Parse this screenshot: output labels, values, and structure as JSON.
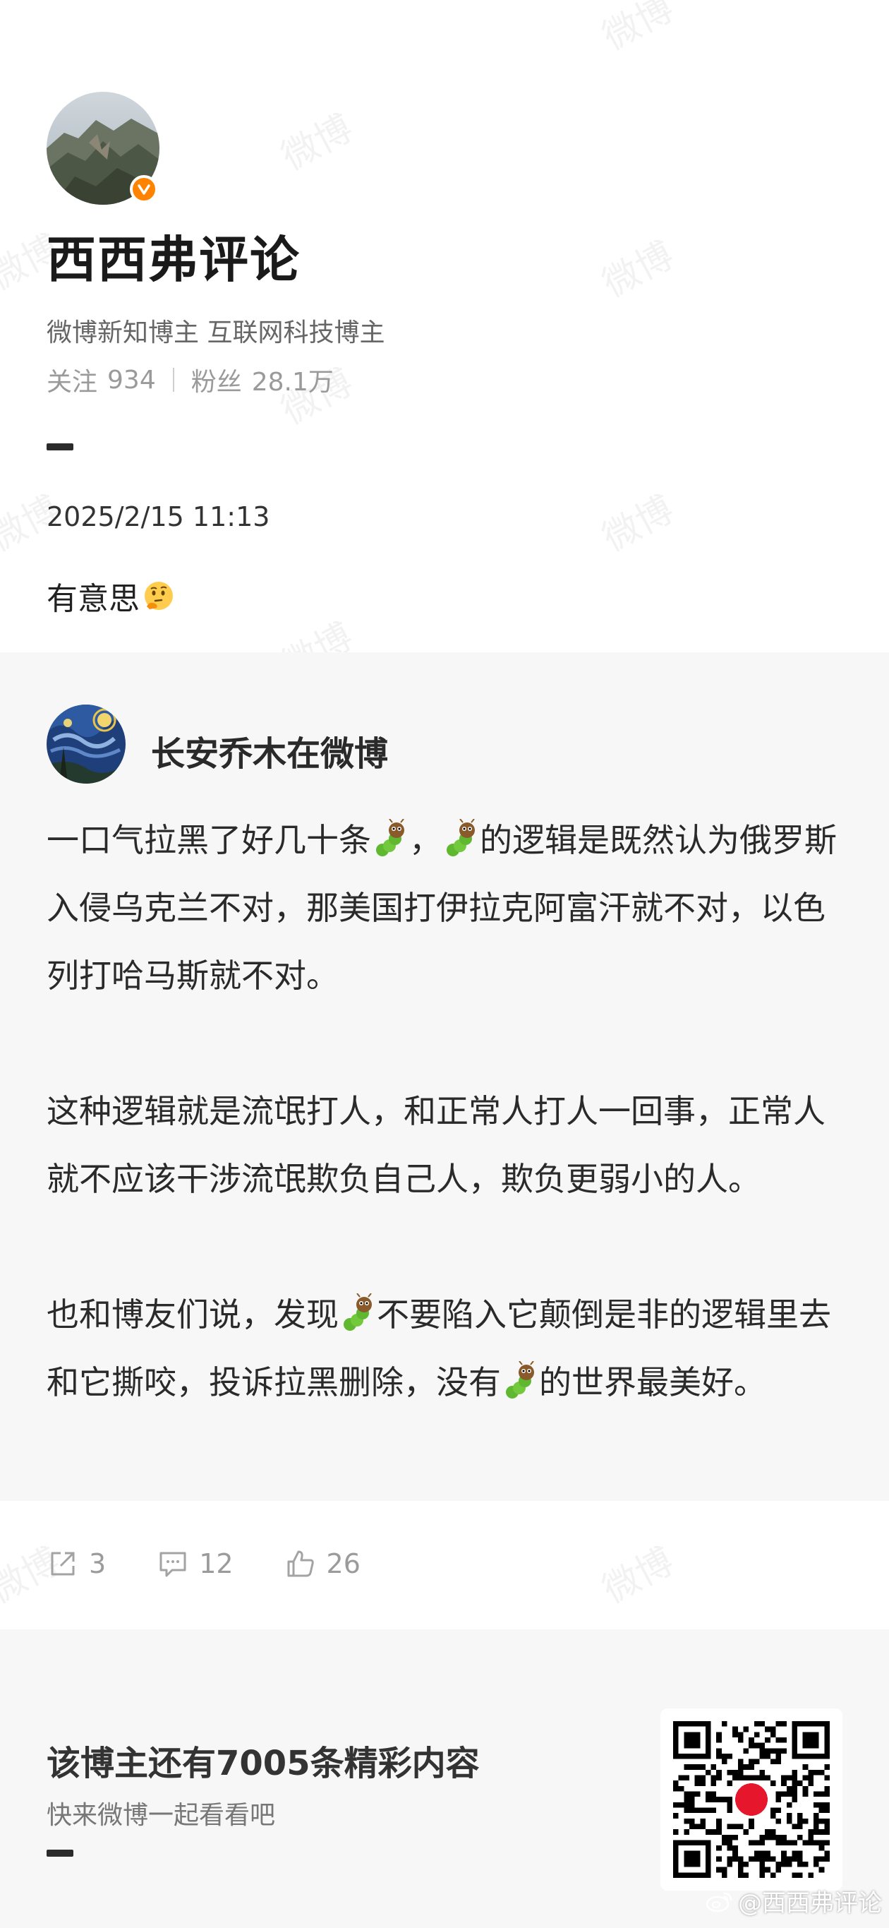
{
  "profile": {
    "name": "西西弗评论",
    "tags": "微博新知博主 互联网科技博主",
    "follow_label": "关注",
    "follow_count": "934",
    "fans_label": "粉丝",
    "fans_count": "28.1万",
    "verified_color": "#ff8200"
  },
  "post": {
    "time": "2025/2/15 11:13",
    "text": "有意思",
    "emoji": "thinking-face"
  },
  "quoted": {
    "author": "长安乔木在微博",
    "paragraphs": [
      {
        "segments": [
          "一口气拉黑了好几十条",
          "bug",
          "，",
          "bug",
          "的逻辑是既然认为俄罗斯入侵乌克兰不对，那美国打伊拉克阿富汗就不对，以色列打哈马斯就不对。"
        ]
      },
      {
        "segments": [
          "这种逻辑就是流氓打人，和正常人打人一回事，正常人就不应该干涉流氓欺负自己人，欺负更弱小的人。"
        ]
      },
      {
        "segments": [
          "也和博友们说，发现",
          "bug",
          "不要陷入它颠倒是非的逻辑里去和它撕咬，投诉拉黑删除，没有",
          "bug",
          "的世界最美好。"
        ]
      }
    ]
  },
  "actions": {
    "share_count": "3",
    "comment_count": "12",
    "like_count": "26"
  },
  "footer": {
    "title": "该博主还有7005条精彩内容",
    "subtitle": "快来微博一起看看吧",
    "handle": "@西西弗评论"
  },
  "watermark_text": "微博"
}
